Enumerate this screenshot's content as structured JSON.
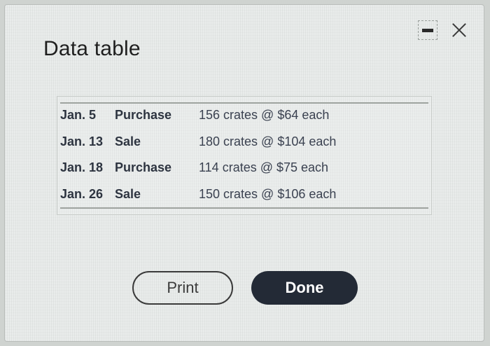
{
  "dialog": {
    "title": "Data table",
    "print_label": "Print",
    "done_label": "Done"
  },
  "table": {
    "rows": [
      {
        "date": "Jan. 5",
        "type": "Purchase",
        "detail": "156 crates @ $64 each"
      },
      {
        "date": "Jan. 13",
        "type": "Sale",
        "detail": "180 crates @ $104 each"
      },
      {
        "date": "Jan. 18",
        "type": "Purchase",
        "detail": "114 crates @ $75 each"
      },
      {
        "date": "Jan. 26",
        "type": "Sale",
        "detail": "150 crates @ $106 each"
      }
    ]
  },
  "icons": {
    "minimize": "minimize-icon",
    "close": "close-icon"
  },
  "colors": {
    "done_button": "#232a36",
    "dialog_background": "#e9eceb"
  }
}
